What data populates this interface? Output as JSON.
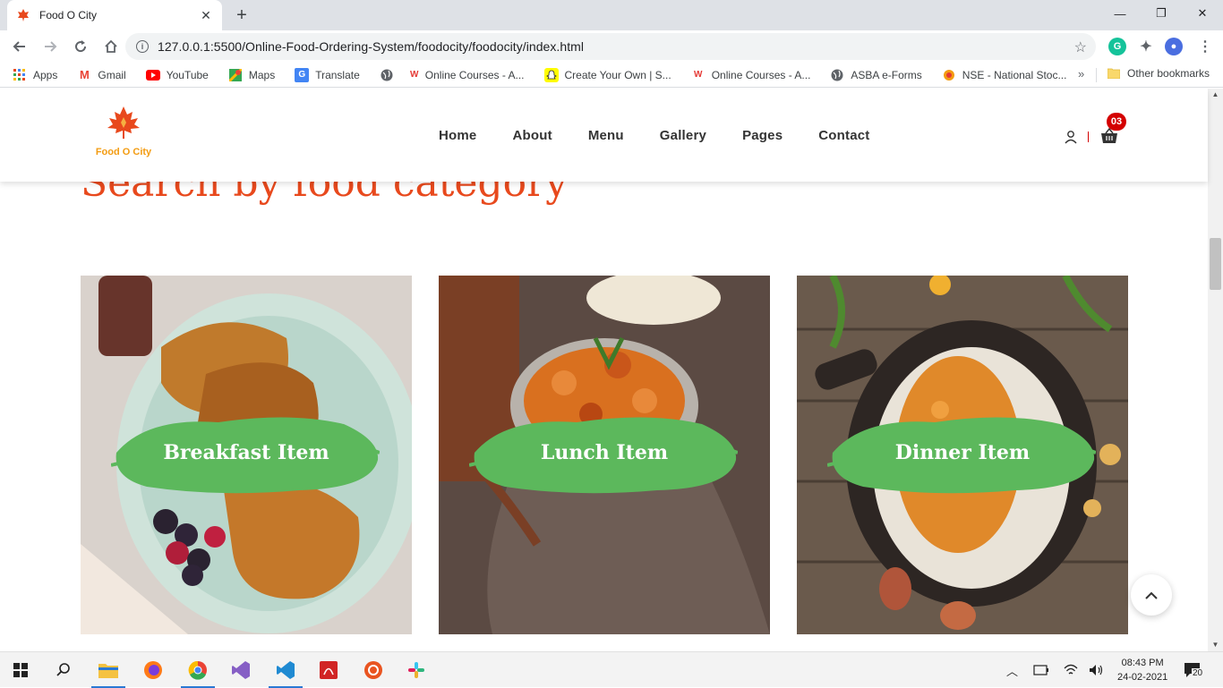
{
  "browser": {
    "tab_title": "Food O City",
    "tab_close": "✕",
    "new_tab": "+",
    "url": "127.0.0.1:5500/Online-Food-Ordering-System/foodocity/foodocity/index.html",
    "win_minimize": "—",
    "win_restore": "❐",
    "win_close": "✕",
    "bookmarks": [
      {
        "label": "Apps",
        "icon": "apps-grid-icon"
      },
      {
        "label": "Gmail",
        "icon": "gmail-icon"
      },
      {
        "label": "YouTube",
        "icon": "youtube-icon"
      },
      {
        "label": "Maps",
        "icon": "maps-icon"
      },
      {
        "label": "Translate",
        "icon": "translate-icon"
      },
      {
        "label": "Online Courses - A...",
        "icon": "globe-icon"
      },
      {
        "label": "Create Your Own | S...",
        "icon": "snapchat-icon"
      },
      {
        "label": "Online Courses - A...",
        "icon": "coursera-icon"
      },
      {
        "label": "ASBA e-Forms",
        "icon": "globe-icon"
      },
      {
        "label": "NSE - National Stoc...",
        "icon": "nse-icon"
      }
    ],
    "bookmarks_more": "»",
    "other_bookmarks": "Other bookmarks"
  },
  "site": {
    "logo_text": "Food O City",
    "nav": [
      "Home",
      "About",
      "Menu",
      "Gallery",
      "Pages",
      "Contact"
    ],
    "cart_count": "03",
    "section_title": "Search by food category",
    "categories": [
      {
        "label": "Breakfast Item"
      },
      {
        "label": "Lunch Item"
      },
      {
        "label": "Dinner Item"
      }
    ]
  },
  "taskbar": {
    "time": "08:43 PM",
    "date": "24-02-2021",
    "notification_count": "20"
  },
  "colors": {
    "accent_red": "#e8491d",
    "badge_red": "#d40000",
    "brush_green": "#5cb85c"
  }
}
